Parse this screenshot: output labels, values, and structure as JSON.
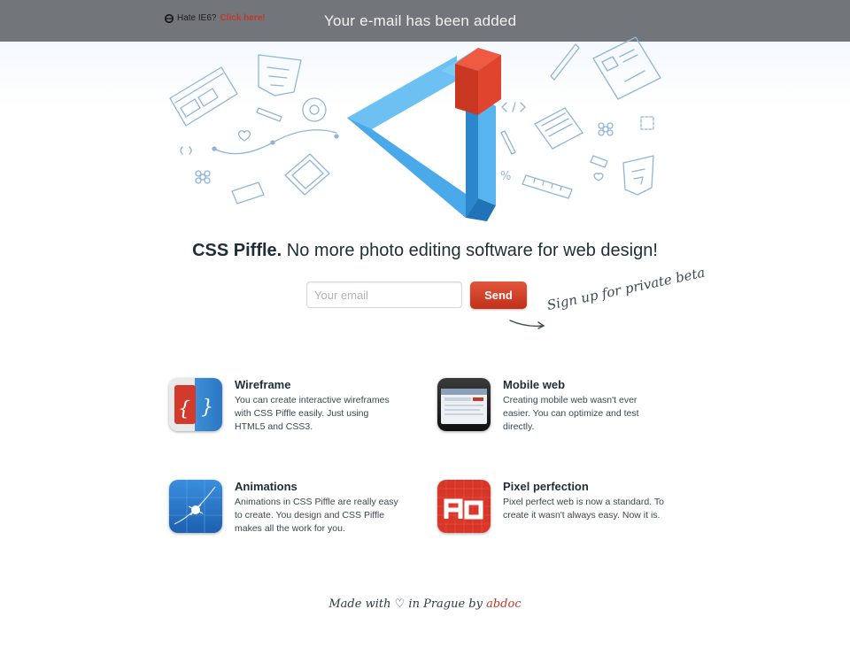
{
  "top_bar": {
    "ie_prefix": "Hate IE6?",
    "ie_link": "Click here!",
    "notification": "Your e-mail has been added"
  },
  "headline": {
    "brand": "CSS Piffle.",
    "tagline": "No more photo editing software for web design!"
  },
  "signup": {
    "email_placeholder": "Your email",
    "send_label": "Send",
    "note": "Sign up for private beta"
  },
  "features": [
    {
      "title": "Wireframe",
      "description": "You can create interactive wireframes with CSS Piffle easily. Just using HTML5 and CSS3.",
      "icon": "wireframe-icon"
    },
    {
      "title": "Mobile web",
      "description": "Creating mobile web wasn't ever easier. You can optimize and test directly.",
      "icon": "mobile-phone-icon"
    },
    {
      "title": "Animations",
      "description": "Animations in CSS Piffle are really easy to create. You design and CSS Piffle makes all the work for you.",
      "icon": "animation-icon"
    },
    {
      "title": "Pixel perfection",
      "description": "Pixel perfect web is now a standard. To create it wasn't always easy. Now it is.",
      "icon": "pixel-icon"
    }
  ],
  "footer": {
    "made_with": "Made with",
    "in_place": "in Prague by",
    "author": "abdoc"
  },
  "colors": {
    "top_bar": "#727579",
    "accent_red": "#c2301a",
    "triangle_blue": "#3fa0e0",
    "sketch_blue": "#8fb6d8"
  }
}
